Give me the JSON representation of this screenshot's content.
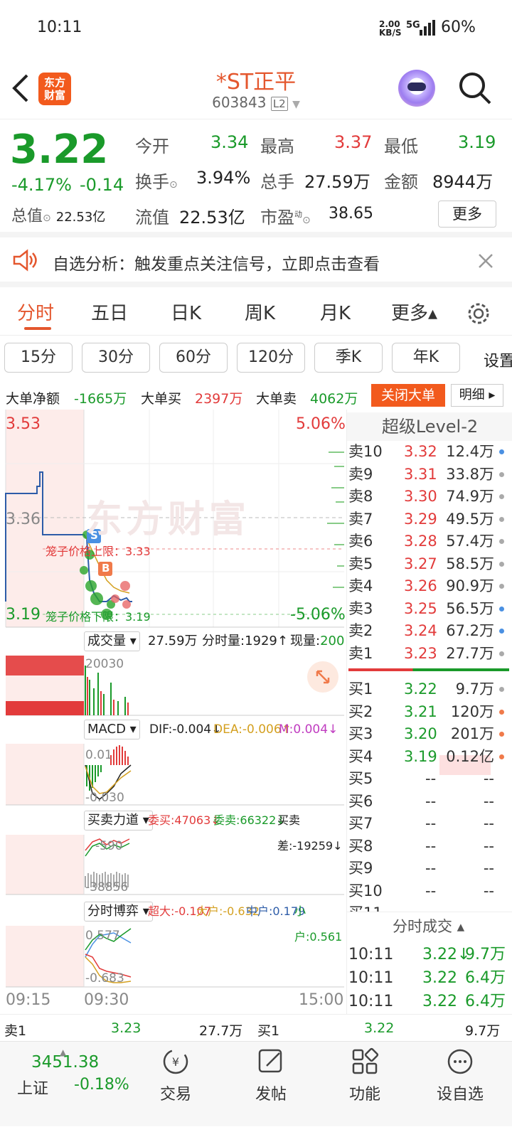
{
  "status": {
    "time": "10:11",
    "net_speed_top": "2.00",
    "net_speed_unit": "KB/S",
    "signal": "5G",
    "battery": "60%"
  },
  "header": {
    "logo_line1": "东方",
    "logo_line2": "财富",
    "title": "*ST正平",
    "code": "603843",
    "level_badge": "L2"
  },
  "quote": {
    "price": "3.22",
    "change_pct": "-4.17%",
    "change": "-0.14",
    "open_label": "今开",
    "open": "3.34",
    "high_label": "最高",
    "high": "3.37",
    "low_label": "最低",
    "low": "3.19",
    "turnover_label": "换手",
    "turnover": "3.94%",
    "volume_label": "总手",
    "volume": "27.59万",
    "amount_label": "金额",
    "amount": "8944万",
    "mcap_label": "总值",
    "mcap": "22.53亿",
    "float_label": "流值",
    "float_cap": "22.53亿",
    "pe_label": "市盈",
    "pe_sup": "动",
    "pe": "38.65",
    "more_button": "更多"
  },
  "notice": {
    "text": "自选分析：触发重点关注信号，立即点击查看"
  },
  "tabs": [
    "分时",
    "五日",
    "日K",
    "周K",
    "月K",
    "更多▴"
  ],
  "subtabs": [
    "15分",
    "30分",
    "60分",
    "120分",
    "季K",
    "年K",
    "设置"
  ],
  "bigorder": {
    "net_label": "大单净额",
    "net": "-1665万",
    "buy_label": "大单买",
    "buy": "2397万",
    "sell_label": "大单卖",
    "sell": "4062万",
    "close_button": "关闭大单",
    "detail_button": "明细 ▸"
  },
  "chart": {
    "price_top": "3.53",
    "pct_top": "5.06%",
    "price_mid": "3.36",
    "price_bottom": "3.19",
    "pct_bottom": "-5.06%",
    "upper_limit_text": "笼子价格上限：3.33",
    "lower_limit_text": "笼子价格下限：3.19",
    "watermark": "东方财富",
    "marker_s": "S",
    "marker_b": "B",
    "time_start": "09:15",
    "time_open": "09:30",
    "time_end": "15:00"
  },
  "volume_bar": {
    "button": "成交量 ▾",
    "total": "27.59万",
    "tick_label": "分时量:1929↑",
    "now_label": "现量:",
    "now": "200",
    "axis": "20030"
  },
  "macd": {
    "button": "MACD ▾",
    "dif": "DIF:-0.004↓",
    "dea": "DEA:-0.006↑",
    "m": "M:0.004↓",
    "axis_top": "0.01",
    "axis_bottom": "-0.030"
  },
  "power": {
    "button": "买卖力道 ▾",
    "buy": "委买:47063↓",
    "sell": "委卖:66322↓",
    "diff": "买卖差:-19259↓",
    "axis_top": "-590",
    "axis_bottom": "-38856"
  },
  "game": {
    "button": "分时博弈 ▾",
    "xl": "超大:-0.107",
    "l": "大户:-0.632",
    "m": "中户:0.179",
    "s": "小户:0.561",
    "axis_top": "0.577",
    "axis_bottom": "-0.683"
  },
  "level2": {
    "title": "超级Level-2",
    "asks": [
      {
        "label": "卖10",
        "price": "3.32",
        "vol": "12.4万"
      },
      {
        "label": "卖9",
        "price": "3.31",
        "vol": "33.8万"
      },
      {
        "label": "卖8",
        "price": "3.30",
        "vol": "74.9万"
      },
      {
        "label": "卖7",
        "price": "3.29",
        "vol": "49.5万"
      },
      {
        "label": "卖6",
        "price": "3.28",
        "vol": "57.4万"
      },
      {
        "label": "卖5",
        "price": "3.27",
        "vol": "58.5万"
      },
      {
        "label": "卖4",
        "price": "3.26",
        "vol": "90.9万"
      },
      {
        "label": "卖3",
        "price": "3.25",
        "vol": "56.5万"
      },
      {
        "label": "卖2",
        "price": "3.24",
        "vol": "67.2万"
      },
      {
        "label": "卖1",
        "price": "3.23",
        "vol": "27.7万"
      }
    ],
    "bids": [
      {
        "label": "买1",
        "price": "3.22",
        "vol": "9.7万"
      },
      {
        "label": "买2",
        "price": "3.21",
        "vol": "120万"
      },
      {
        "label": "买3",
        "price": "3.20",
        "vol": "201万"
      },
      {
        "label": "买4",
        "price": "3.19",
        "vol": "0.12亿"
      },
      {
        "label": "买5",
        "price": "--",
        "vol": "--"
      },
      {
        "label": "买6",
        "price": "--",
        "vol": "--"
      },
      {
        "label": "买7",
        "price": "--",
        "vol": "--"
      },
      {
        "label": "买8",
        "price": "--",
        "vol": "--"
      },
      {
        "label": "买9",
        "price": "--",
        "vol": "--"
      },
      {
        "label": "买10",
        "price": "--",
        "vol": "--"
      },
      {
        "label": "买11",
        "price": "--",
        "vol": "--"
      }
    ],
    "ticks_title": "分时成交 ▴",
    "ticks": [
      {
        "time": "10:11",
        "price": "3.22↓",
        "vol": "9.7万"
      },
      {
        "time": "10:11",
        "price": "3.22",
        "vol": "6.4万"
      },
      {
        "time": "10:11",
        "price": "3.22",
        "vol": "6.4万"
      }
    ]
  },
  "bottom_quote": {
    "sell_label": "卖1",
    "sell_price": "3.23",
    "sell_vol": "27.7万",
    "buy_label": "买1",
    "buy_price": "3.22",
    "buy_vol": "9.7万"
  },
  "nav": {
    "index_value": "3451.38",
    "index_name": "上证",
    "index_change": "-0.18%",
    "items": [
      "交易",
      "发帖",
      "功能",
      "设自选"
    ]
  }
}
